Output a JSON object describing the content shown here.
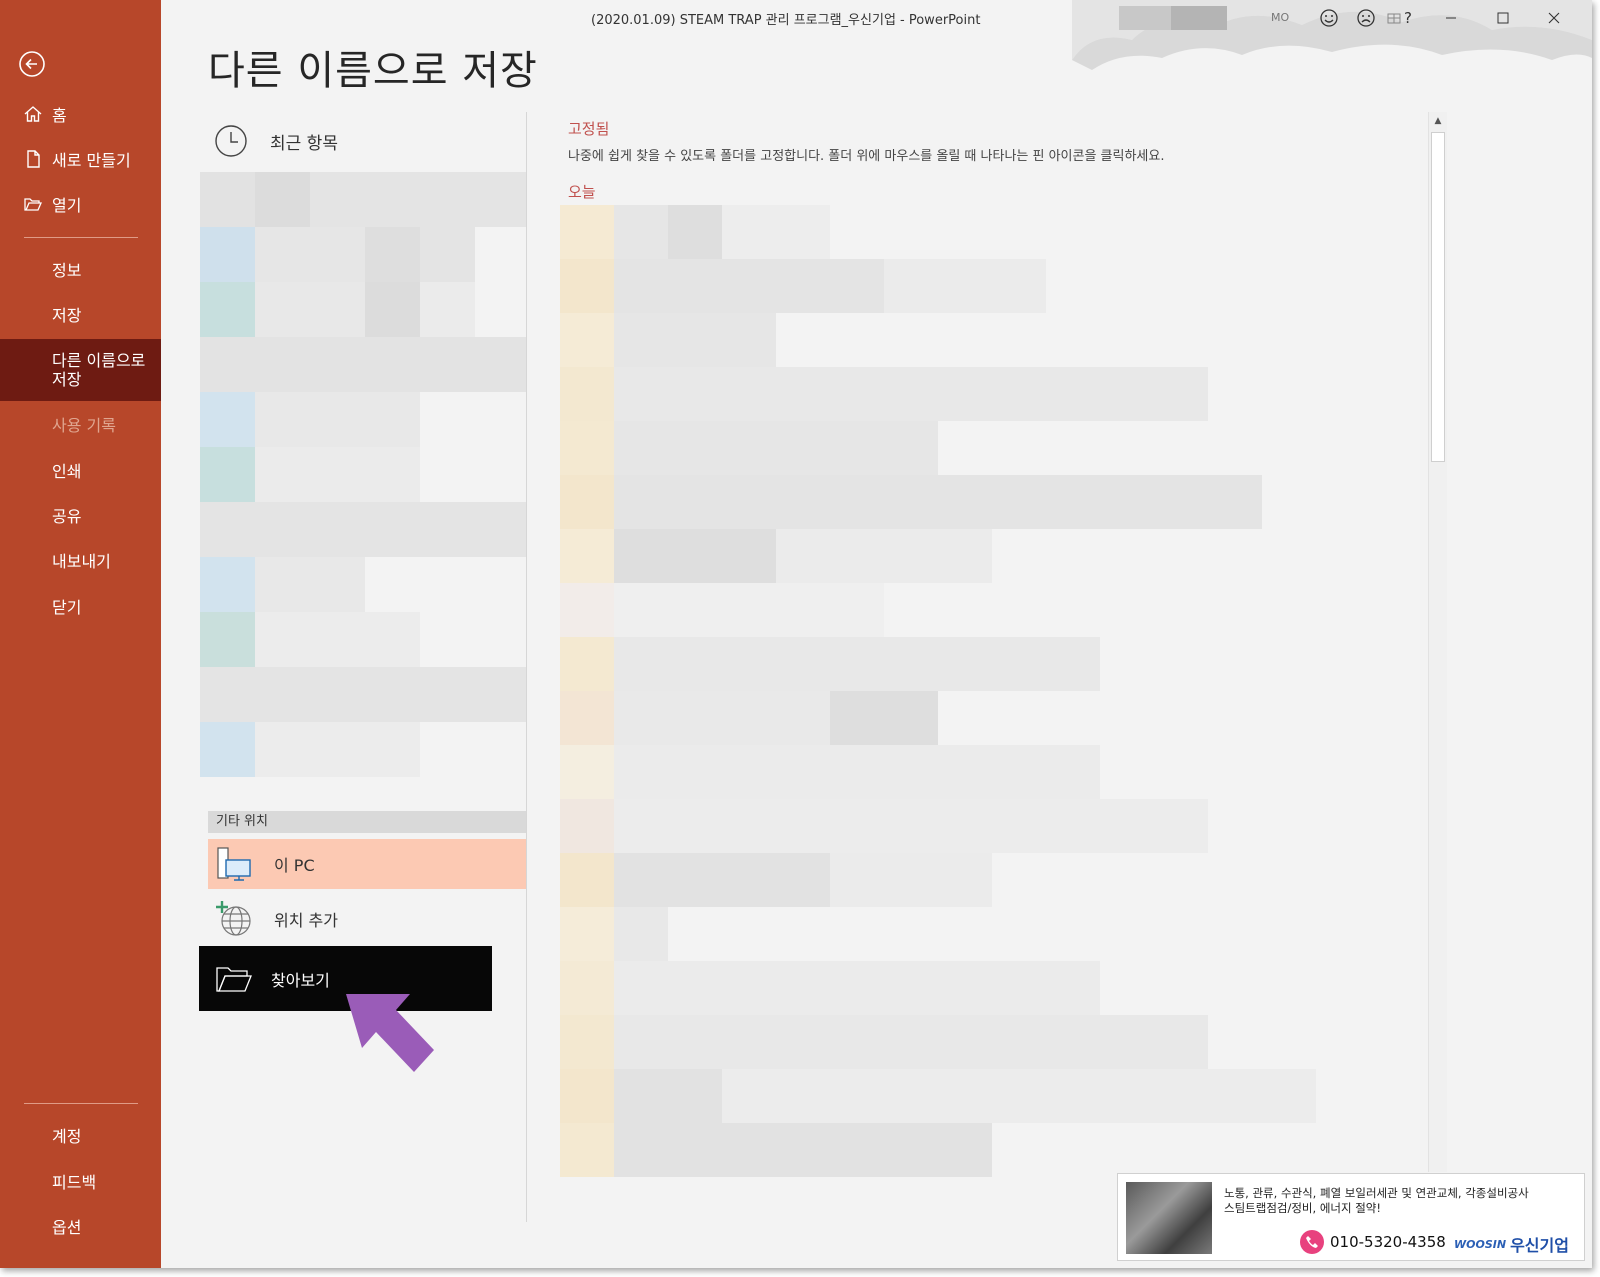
{
  "window": {
    "title": "(2020.01.09) STEAM TRAP 관리 프로그램_우신기업  -  PowerPoint",
    "user_initials": "MO"
  },
  "sidebar": {
    "top_items": [
      {
        "label": "홈",
        "icon": "home-icon"
      },
      {
        "label": "새로 만들기",
        "icon": "new-document-icon"
      },
      {
        "label": "열기",
        "icon": "open-folder-icon"
      }
    ],
    "items": [
      {
        "label": "정보"
      },
      {
        "label": "저장"
      },
      {
        "label": "다른 이름으로 저장",
        "selected": true
      },
      {
        "label": "사용 기록",
        "disabled": true
      },
      {
        "label": "인쇄"
      },
      {
        "label": "공유"
      },
      {
        "label": "내보내기"
      },
      {
        "label": "닫기"
      }
    ],
    "bottom_items": [
      {
        "label": "계정"
      },
      {
        "label": "피드백"
      },
      {
        "label": "옵션"
      }
    ]
  },
  "page": {
    "title": "다른 이름으로 저장"
  },
  "locations": {
    "recent_label": "최근 항목",
    "other_header": "기타 위치",
    "this_pc": "이 PC",
    "add_place": "위치 추가",
    "browse": "찾아보기"
  },
  "right_pane": {
    "pinned_title": "고정됨",
    "pinned_desc": "나중에 쉽게 찾을 수 있도록 폴더를 고정합니다. 폴더 위에 마우스를 올릴 때 나타나는 핀 아이콘을 클릭하세요.",
    "today_title": "오늘"
  },
  "ad": {
    "line1": "노통, 관류, 수관식, 폐열 보일러세관 및 연관교체, 각종설비공사",
    "line2": "스팀트랩점검/정비, 에너지 절약!",
    "phone": "010-5320-4358",
    "brand_en": "WOOSIN",
    "brand_kr": "우신기업"
  },
  "colors": {
    "accent": "#b7472a",
    "selected_nav": "#6e1b12",
    "selected_location": "#fcc9b3",
    "section_title": "#c0504d"
  }
}
